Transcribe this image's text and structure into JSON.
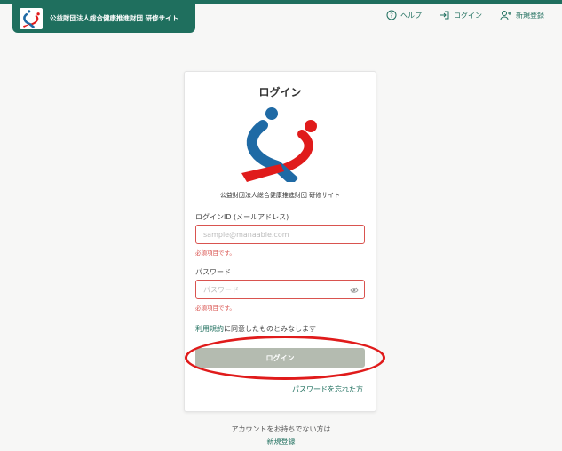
{
  "header": {
    "brand_text": "公益財団法人総合健康推進財団 研修サイト",
    "nav": [
      {
        "label": "ヘルプ",
        "icon": "help-icon"
      },
      {
        "label": "ログイン",
        "icon": "login-icon"
      },
      {
        "label": "新規登録",
        "icon": "add-user-icon"
      }
    ]
  },
  "login": {
    "title": "ログイン",
    "org_name": "公益財団法人総合健康推進財団 研修サイト",
    "id_label": "ログインID (メールアドレス)",
    "id_placeholder": "sample@manaable.com",
    "id_error": "必須項目です。",
    "password_label": "パスワード",
    "password_placeholder": "パスワード",
    "password_error": "必須項目です。",
    "terms_link": "利用規約",
    "terms_rest": "に同意したものとみなします",
    "submit_label": "ログイン",
    "forgot_label": "パスワードを忘れた方"
  },
  "footer": {
    "no_account": "アカウントをお持ちでない方は",
    "register_label": "新規登録"
  },
  "colors": {
    "brand": "#1f6f5e",
    "error": "#d9534f",
    "button_disabled": "#b4bbb0",
    "annotation": "#e01b1b"
  }
}
